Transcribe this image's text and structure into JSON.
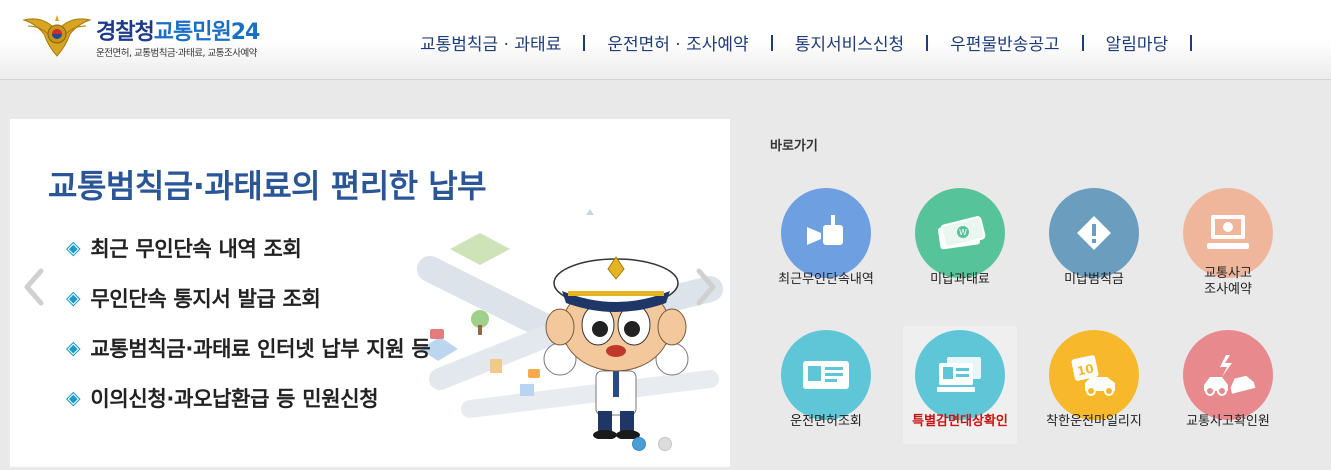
{
  "header": {
    "brand": {
      "part1": "경찰청",
      "part2": "교통민원24",
      "subtitle": "운전면허, 교통범칙금·과태료, 교통조사예약"
    },
    "nav": [
      {
        "label": "교통범칙금 · 과태료"
      },
      {
        "label": "운전면허 · 조사예약"
      },
      {
        "label": "통지서비스신청"
      },
      {
        "label": "우편물반송공고"
      },
      {
        "label": "알림마당"
      }
    ]
  },
  "banner": {
    "title": "교통범칙금·과태료의 편리한 납부",
    "bullets": [
      "최근 무인단속 내역 조회",
      "무인단속 통지서 발급 조회",
      "교통범칙금·과태료 인터넷 납부 지원 등",
      "이의신청·과오납환급 등 민원신청"
    ],
    "bullet_symbol": "◈",
    "slides_total": 2,
    "slide_active": 1
  },
  "quick": {
    "title": "바로가기",
    "items": [
      {
        "line1": "최근무인단속내역",
        "line2": "",
        "color": "#6e9fe0",
        "icon": "camera-icon"
      },
      {
        "line1": "미납과태료",
        "line2": "",
        "color": "#57c39a",
        "icon": "money-icon"
      },
      {
        "line1": "미납범칙금",
        "line2": "",
        "color": "#6b9dbf",
        "icon": "warning-icon"
      },
      {
        "line1": "교통사고",
        "line2": "조사예약",
        "color": "#f0b69b",
        "icon": "monitor-icon"
      },
      {
        "line1": "운전면허조회",
        "line2": "",
        "color": "#5ec6d6",
        "icon": "license-card-icon"
      },
      {
        "line1": "특별감면대상확인",
        "line2": "",
        "color": "#5ec6d6",
        "icon": "document-check-icon"
      },
      {
        "line1": "착한운전마일리지",
        "line2": "",
        "color": "#f7b92b",
        "icon": "mileage-icon"
      },
      {
        "line1": "교통사고확인원",
        "line2": "",
        "color": "#e8898d",
        "icon": "car-crash-icon"
      }
    ]
  },
  "colors": {
    "nav_text": "#1e3c78",
    "title_blue": "#2a5698",
    "bullet_blue": "#1a9ac8",
    "highlight_red": "#cc1111"
  }
}
